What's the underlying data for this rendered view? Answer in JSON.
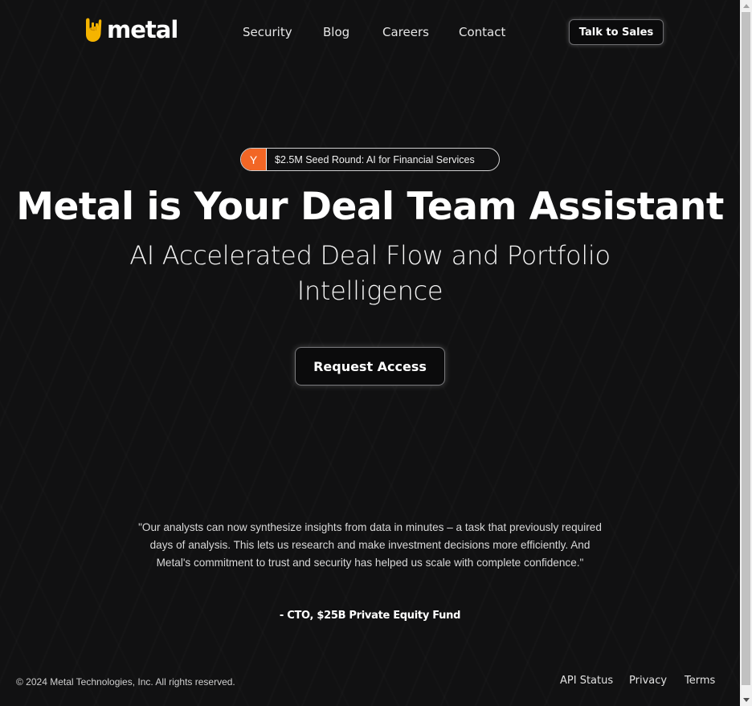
{
  "header": {
    "brand": "metal",
    "logo_icon": "rock-hand-icon",
    "nav": [
      {
        "label": "Security"
      },
      {
        "label": "Blog"
      },
      {
        "label": "Careers"
      },
      {
        "label": "Contact"
      }
    ],
    "cta_label": "Talk to Sales"
  },
  "announcement": {
    "badge_letter": "Y",
    "text": "$2.5M Seed Round: AI for Financial Services",
    "badge_color": "#f26625"
  },
  "hero": {
    "title": "Metal is Your Deal Team Assistant",
    "subtitle": "AI Accelerated Deal Flow and Portfolio Intelligence",
    "button_label": "Request Access"
  },
  "testimonial": {
    "quote": "\"Our analysts can now synthesize insights from data in minutes – a task that previously required days of analysis. This lets us research and make investment decisions more efficiently. And Metal's commitment to trust and security has helped us scale with complete confidence.\"",
    "author": "- CTO, $25B Private Equity Fund"
  },
  "footer": {
    "copyright": "© 2024 Metal Technologies, Inc. All rights reserved.",
    "links": [
      {
        "label": "API Status"
      },
      {
        "label": "Privacy"
      },
      {
        "label": "Terms"
      }
    ]
  },
  "colors": {
    "background": "#111112",
    "text": "#ffffff",
    "accent": "#f26625",
    "logo_hand": "#f5b400"
  }
}
